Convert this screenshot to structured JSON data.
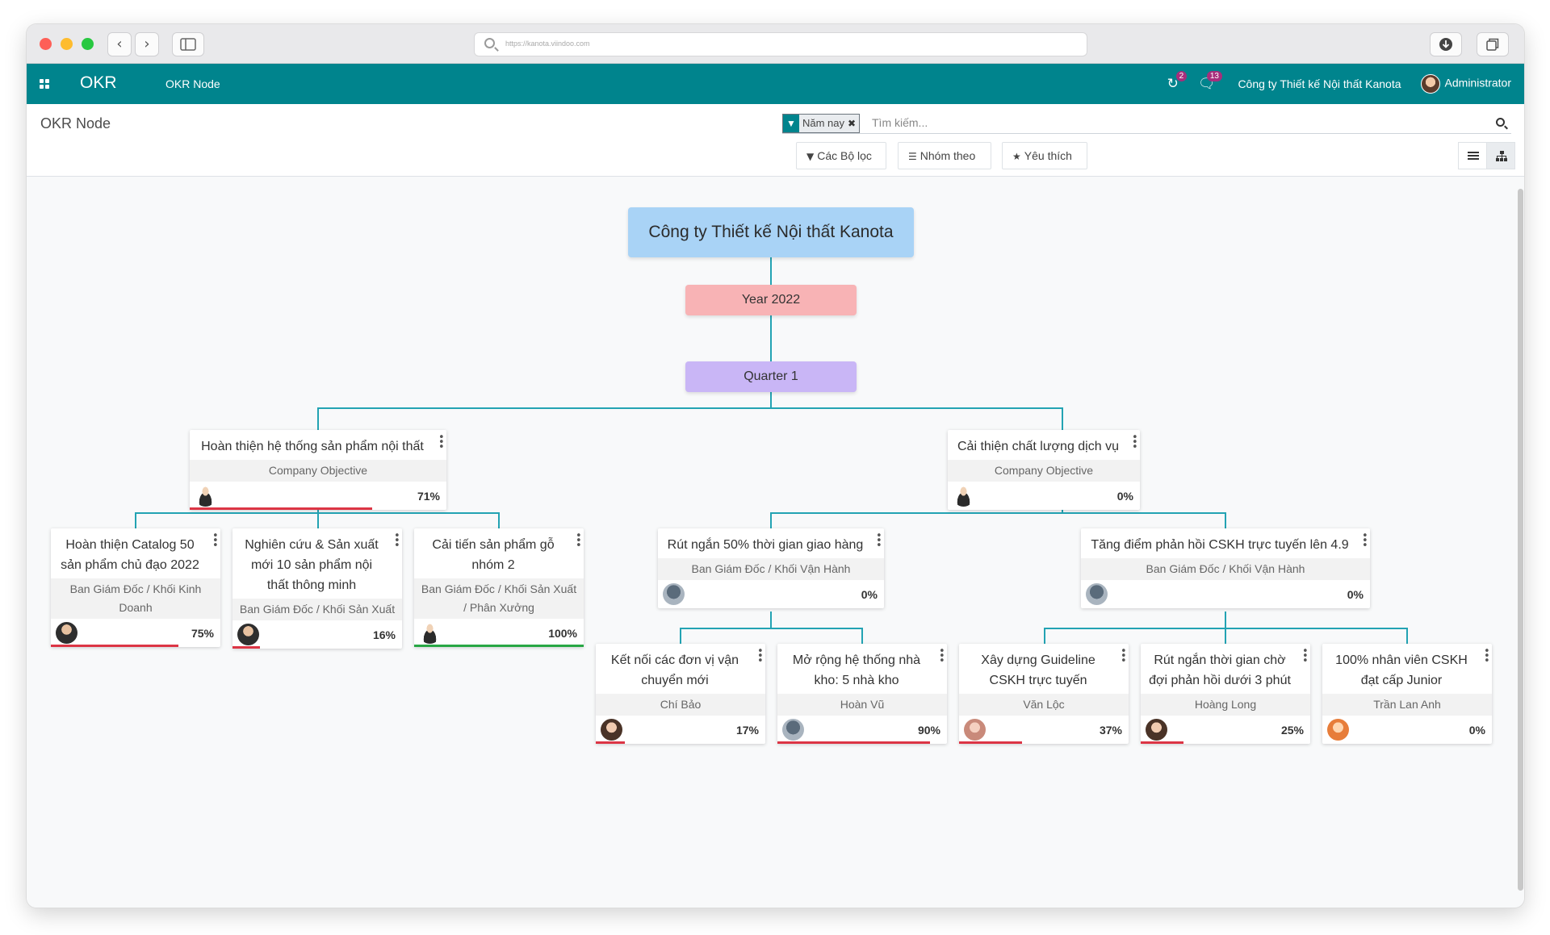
{
  "browser": {
    "url": "https://kanota.viindoo.com",
    "back": "‹",
    "forward": "›"
  },
  "navbar": {
    "brand": "OKR",
    "menu": "OKR Node",
    "activity_count": "2",
    "message_count": "13",
    "company": "Công ty Thiết kế Nội thất Kanota",
    "user": "Administrator",
    "primary_color": "#00848d"
  },
  "control_panel": {
    "breadcrumb": "OKR Node",
    "facet_label": "Năm nay",
    "search_placeholder": "Tìm kiếm...",
    "filters_label": "Các Bộ lọc",
    "groupby_label": "Nhóm theo",
    "favorites_label": "Yêu thích",
    "active_view": "hierarchy"
  },
  "tree": {
    "root": "Công ty Thiết kế Nội thất Kanota",
    "year": "Year 2022",
    "quarter": "Quarter 1",
    "objectives": [
      {
        "title": "Hoàn thiện hệ thống sản phẩm nội thất",
        "subtitle": "Company Objective",
        "progress": "71%",
        "children": [
          {
            "title": "Hoàn thiện Catalog 50 sản phẩm chủ đạo 2022",
            "subtitle": "Ban Giám Đốc / Khối Kinh Doanh",
            "progress": "75%"
          },
          {
            "title": "Nghiên cứu & Sản xuất mới 10 sản phẩm nội thất thông minh",
            "subtitle": "Ban Giám Đốc / Khối Sản Xuất",
            "progress": "16%"
          },
          {
            "title": "Cải tiến sản phẩm gỗ nhóm 2",
            "subtitle": "Ban Giám Đốc / Khối Sản Xuất / Phân Xưởng",
            "progress": "100%"
          }
        ]
      },
      {
        "title": "Cải thiện chất lượng dịch vụ",
        "subtitle": "Company Objective",
        "progress": "0%",
        "children": [
          {
            "title": "Rút ngắn 50% thời gian giao hàng",
            "subtitle": "Ban Giám Đốc / Khối Vận Hành",
            "progress": "0%",
            "children": [
              {
                "title": "Kết nối các đơn vị vận chuyển mới",
                "subtitle": "Chí Bảo",
                "progress": "17%"
              },
              {
                "title": "Mở rộng hệ thống nhà kho: 5 nhà kho",
                "subtitle": "Hoàn Vũ",
                "progress": "90%"
              }
            ]
          },
          {
            "title": "Tăng điểm phản hồi CSKH trực tuyến lên 4.9",
            "subtitle": "Ban Giám Đốc / Khối Vận Hành",
            "progress": "0%",
            "children": [
              {
                "title": "Xây dựng Guideline CSKH trực tuyến",
                "subtitle": "Văn Lộc",
                "progress": "37%"
              },
              {
                "title": "Rút ngắn thời gian chờ đợi phản hồi dưới 3 phút",
                "subtitle": "Hoàng Long",
                "progress": "25%"
              },
              {
                "title": "100% nhân viên CSKH đạt cấp Junior",
                "subtitle": "Trần Lan Anh",
                "progress": "0%"
              }
            ]
          }
        ]
      }
    ]
  }
}
